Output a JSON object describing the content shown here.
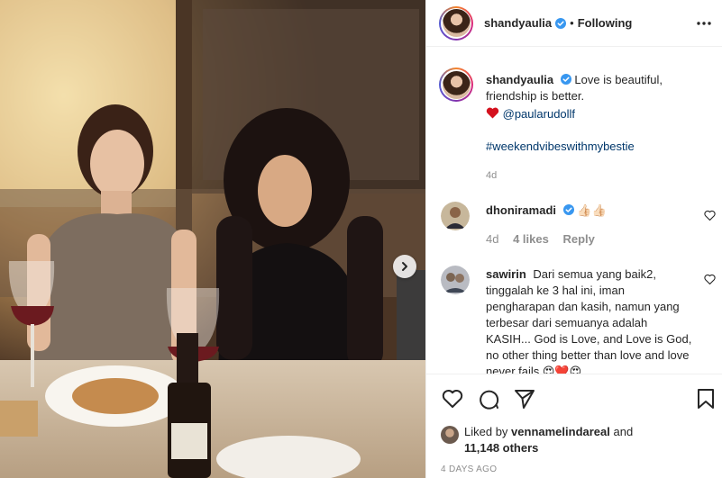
{
  "post": {
    "username": "shandyaulia",
    "dot": "•",
    "follow_status": "Following",
    "verified": true
  },
  "caption": {
    "username": "shandyaulia",
    "line1": "Love is beautiful, friendship is better.",
    "mention": "@paularudollf",
    "hashtag": "#weekendvibeswithmybestie",
    "age": "4d"
  },
  "comments": [
    {
      "username": "dhoniramadi",
      "verified": true,
      "text": "👍🏻👍🏻",
      "age": "4d",
      "likes": "4 likes",
      "reply_label": "Reply"
    },
    {
      "username": "sawirin",
      "text": "Dari semua yang baik2, tinggalah ke 3 hal ini, iman pengharapan dan kasih, namun yang terbesar dari semuanya adalah KASIH... God is Love, and Love is God, no other thing better than",
      "text_cont": "love and love never fails 😍❤️😍"
    }
  ],
  "likes": {
    "prefix": "Liked by",
    "user": "vennamelindareal",
    "joiner": "and",
    "count": "11,148 others"
  },
  "timestamp": "4 DAYS AGO",
  "colors": {
    "link": "#00376b",
    "verified": "#3897f0",
    "heart": "#ed4956",
    "muted": "#8e8e8e"
  },
  "icons": [
    "more-icon",
    "verified-icon",
    "heart-icon",
    "comment-icon",
    "share-icon",
    "bookmark-icon",
    "chevron-right-icon"
  ]
}
